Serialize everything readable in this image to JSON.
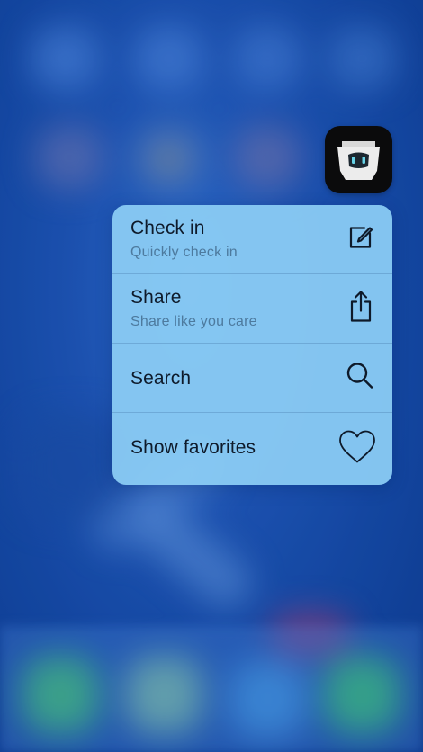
{
  "home_screen": {
    "description_colors": {
      "background": "#1f57b9",
      "menu_background": "#8ccdf5",
      "title_text": "#0e1a2a",
      "subtitle_text": "#4d7a9e"
    }
  },
  "app": {
    "icon": "robot-helmet-icon"
  },
  "quick_actions": [
    {
      "title": "Check in",
      "subtitle": "Quickly check in",
      "icon": "compose-icon"
    },
    {
      "title": "Share",
      "subtitle": "Share like you care",
      "icon": "share-icon"
    },
    {
      "title": "Search",
      "subtitle": "",
      "icon": "search-icon"
    },
    {
      "title": "Show favorites",
      "subtitle": "",
      "icon": "heart-icon"
    }
  ]
}
